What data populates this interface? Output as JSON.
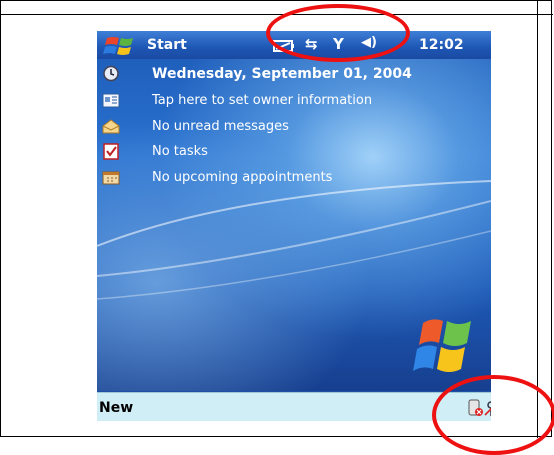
{
  "taskbar": {
    "start_label": "Start",
    "clock": "12:02",
    "status_icons": [
      "battery-icon",
      "connectivity-icon",
      "signal-off-icon",
      "volume-icon"
    ]
  },
  "today": {
    "date": "Wednesday, September 01, 2004",
    "owner": "Tap here to set owner information",
    "messages": "No unread messages",
    "tasks": "No tasks",
    "appointments": "No upcoming appointments"
  },
  "menubar": {
    "new_label": "New",
    "tray_icons": [
      "bluetooth-off-icon",
      "wireless-off-icon"
    ]
  },
  "annotations": {
    "color": "#e11111"
  }
}
